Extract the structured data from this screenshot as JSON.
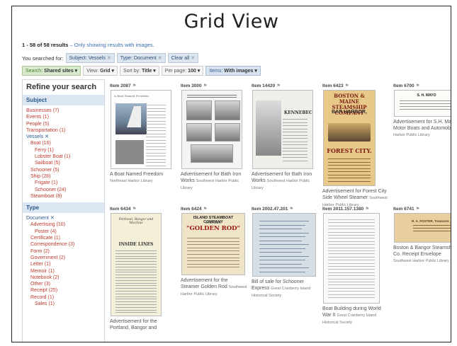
{
  "slide_title": "Grid View",
  "results": {
    "count_text": "1 - 58 of 58 results",
    "note": "– Only showing results with images."
  },
  "search": {
    "prefix": "You searched for:",
    "chips": [
      "Subject: Vessels",
      "Type: Document"
    ],
    "clear": "Clear all"
  },
  "toolbar": {
    "search_prefix": "Search:",
    "search_value": "Shared sites ▾",
    "view_prefix": "View:",
    "view_value": "Grid ▾",
    "sort_prefix": "Sort by:",
    "sort_value": "Title ▾",
    "perpage_prefix": "Per page:",
    "perpage_value": "100 ▾",
    "items_prefix": "Items:",
    "items_value": "With images ▾"
  },
  "sidebar": {
    "title": "Refine your search",
    "subject_head": "Subject",
    "subject_items": [
      {
        "label": "Businesses (7)",
        "lvl": 0,
        "sel": false
      },
      {
        "label": "Events (1)",
        "lvl": 0,
        "sel": false
      },
      {
        "label": "People (5)",
        "lvl": 0,
        "sel": false
      },
      {
        "label": "Transportation (1)",
        "lvl": 0,
        "sel": false
      },
      {
        "label": "Vessels ✕",
        "lvl": 0,
        "sel": true
      },
      {
        "label": "Boat (16)",
        "lvl": 1,
        "sel": false
      },
      {
        "label": "Ferry (1)",
        "lvl": 2,
        "sel": false
      },
      {
        "label": "Lobster Boat (1)",
        "lvl": 2,
        "sel": false
      },
      {
        "label": "Sailboat (5)",
        "lvl": 2,
        "sel": false
      },
      {
        "label": "Schooner (5)",
        "lvl": 1,
        "sel": false
      },
      {
        "label": "Ship (28)",
        "lvl": 1,
        "sel": false
      },
      {
        "label": "Frigate (1)",
        "lvl": 2,
        "sel": false
      },
      {
        "label": "Schooner (24)",
        "lvl": 2,
        "sel": false
      },
      {
        "label": "Steamboat (8)",
        "lvl": 1,
        "sel": false
      }
    ],
    "type_head": "Type",
    "type_items": [
      {
        "label": "Document ✕",
        "lvl": 0,
        "sel": true
      },
      {
        "label": "Advertising (10)",
        "lvl": 1,
        "sel": false
      },
      {
        "label": "Poster (4)",
        "lvl": 2,
        "sel": false
      },
      {
        "label": "Certificate (1)",
        "lvl": 1,
        "sel": false
      },
      {
        "label": "Correspondence (3)",
        "lvl": 1,
        "sel": false
      },
      {
        "label": "Form (2)",
        "lvl": 1,
        "sel": false
      },
      {
        "label": "Government (2)",
        "lvl": 1,
        "sel": false
      },
      {
        "label": "Letter (1)",
        "lvl": 1,
        "sel": false
      },
      {
        "label": "Memoir (1)",
        "lvl": 1,
        "sel": false
      },
      {
        "label": "Notebook (2)",
        "lvl": 1,
        "sel": false
      },
      {
        "label": "Other (3)",
        "lvl": 1,
        "sel": false
      },
      {
        "label": "Receipt (25)",
        "lvl": 1,
        "sel": false
      },
      {
        "label": "Record (1)",
        "lvl": 1,
        "sel": false
      },
      {
        "label": "Sales (1)",
        "lvl": 2,
        "sel": false
      }
    ]
  },
  "items": [
    {
      "id": "Item 2087",
      "title": "A Boat Named Freedom",
      "source": "Northeast Harbor Library",
      "kind": "boat-doc"
    },
    {
      "id": "Item 3000",
      "title": "Advertisement for Bath Iron Works",
      "source": "Southwest Harbor Public Library",
      "kind": "ad-photos"
    },
    {
      "id": "Item 14420",
      "title": "Advertisement for Bath Iron Works",
      "source": "Southwest Harbor Public Library",
      "kind": "kennebec"
    },
    {
      "id": "Item 6423",
      "title": "Advertisement for Forest City Side Wheel Steamer",
      "source": "Southwest Harbor Public Library",
      "kind": "poster"
    },
    {
      "id": "Item 6700",
      "title": "Advertisement for S.H. Mayo Motor Boats and Automobiles",
      "source": "Harbor Public Library",
      "kind": "card"
    },
    {
      "id": "Item 6434",
      "title": "Advertisement for the Portland, Bangor and",
      "source": "",
      "kind": "handbill"
    },
    {
      "id": "Item 6424",
      "title": "Advertisement for the Steamer Golden Rod",
      "source": "Southwest Harbor Public Library",
      "kind": "golden-rod"
    },
    {
      "id": "Item 2002.47.201",
      "title": "Bill of sale for Schooner Express",
      "source": "Great Cranberry Island Historical Society",
      "kind": "script"
    },
    {
      "id": "Item 2011.157.1380",
      "title": "Boat Building during World War II",
      "source": "Great Cranberry Island Historical Society",
      "kind": "typed"
    },
    {
      "id": "Item 6741",
      "title": "Boston & Bangor Steamship Co. Receipt Envelope",
      "source": "Southwest Harbor Public Library",
      "kind": "envelope"
    }
  ],
  "art": {
    "poster_title": "BOSTON & MAINE STEAMSHIP COMPANY",
    "poster_mid": "BAR HARBOR,",
    "poster_city": "FOREST CITY.",
    "golden_top": "ISLAND STEAMBOAT COMPANY",
    "golden_mid": "STEAMER",
    "golden_name": "\"GOLDEN ROD\"",
    "mayo_name": "S. H. MAYO",
    "kennebec": "KENNEBEC",
    "boat_doc_title": "A Boat Named Freedom",
    "handbill_head": "Portland, Bangor and Machias",
    "handbill_lines": "INSIDE LINES",
    "envelope_name": "R. A. FOSTER, Treasurer,"
  },
  "colors": {
    "facet_link": "#c0392b",
    "facet_head_bg": "#dbe6f2",
    "poster_bg": "#e8c98a",
    "golden_bg": "#efe3c8"
  }
}
